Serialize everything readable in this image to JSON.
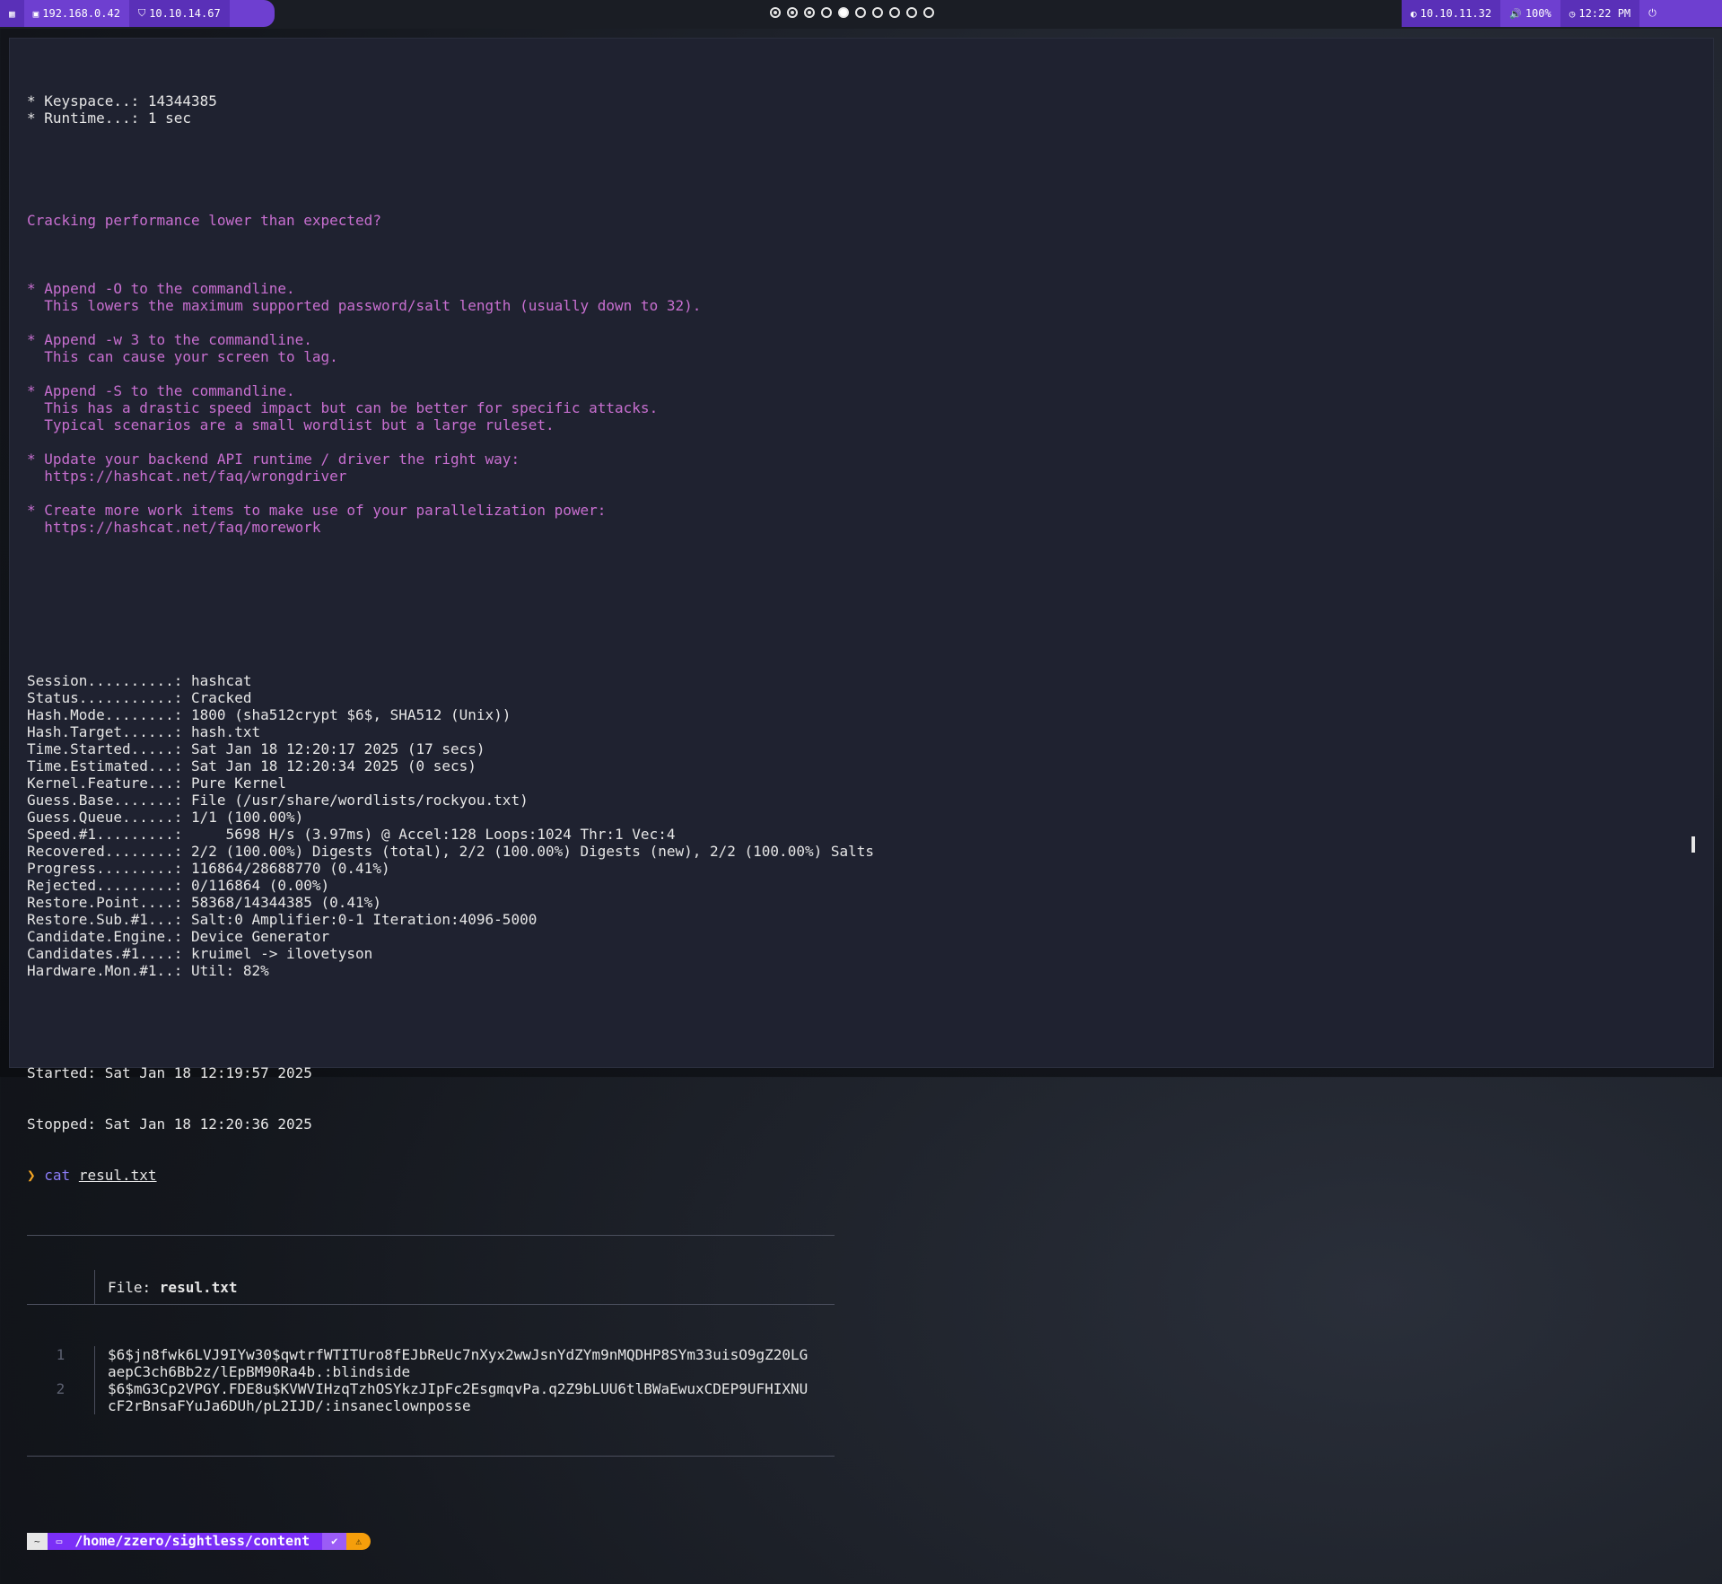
{
  "topbar": {
    "left": {
      "menu_icon": "grid-icon",
      "ip_local": "192.168.0.42",
      "ip_vpn": "10.10.14.67"
    },
    "workspaces": [
      {
        "state": "occupied"
      },
      {
        "state": "occupied"
      },
      {
        "state": "occupied"
      },
      {
        "state": "empty"
      },
      {
        "state": "active"
      },
      {
        "state": "empty"
      },
      {
        "state": "empty"
      },
      {
        "state": "empty"
      },
      {
        "state": "empty"
      },
      {
        "state": "empty"
      }
    ],
    "right": {
      "target_ip": "10.10.11.32",
      "volume": "100%",
      "clock": "12:22 PM",
      "power_icon": "power-icon"
    }
  },
  "terminal": {
    "header_lines": [
      "* Keyspace..: 14344385",
      "* Runtime...: 1 sec"
    ],
    "perf_title": "Cracking performance lower than expected?",
    "perf_blocks": [
      [
        "* Append -O to the commandline.",
        "  This lowers the maximum supported password/salt length (usually down to 32)."
      ],
      [
        "* Append -w 3 to the commandline.",
        "  This can cause your screen to lag."
      ],
      [
        "* Append -S to the commandline.",
        "  This has a drastic speed impact but can be better for specific attacks.",
        "  Typical scenarios are a small wordlist but a large ruleset."
      ],
      [
        "* Update your backend API runtime / driver the right way:",
        "  https://hashcat.net/faq/wrongdriver"
      ],
      [
        "* Create more work items to make use of your parallelization power:",
        "  https://hashcat.net/faq/morework"
      ]
    ],
    "status_lines": [
      "Session..........: hashcat",
      "Status...........: Cracked",
      "Hash.Mode........: 1800 (sha512crypt $6$, SHA512 (Unix))",
      "Hash.Target......: hash.txt",
      "Time.Started.....: Sat Jan 18 12:20:17 2025 (17 secs)",
      "Time.Estimated...: Sat Jan 18 12:20:34 2025 (0 secs)",
      "Kernel.Feature...: Pure Kernel",
      "Guess.Base.......: File (/usr/share/wordlists/rockyou.txt)",
      "Guess.Queue......: 1/1 (100.00%)",
      "Speed.#1.........:     5698 H/s (3.97ms) @ Accel:128 Loops:1024 Thr:1 Vec:4",
      "Recovered........: 2/2 (100.00%) Digests (total), 2/2 (100.00%) Digests (new), 2/2 (100.00%) Salts",
      "Progress.........: 116864/28688770 (0.41%)",
      "Rejected.........: 0/116864 (0.00%)",
      "Restore.Point....: 58368/14344385 (0.41%)",
      "Restore.Sub.#1...: Salt:0 Amplifier:0-1 Iteration:4096-5000",
      "Candidate.Engine.: Device Generator",
      "Candidates.#1....: kruimel -> ilovetyson",
      "Hardware.Mon.#1..: Util: 82%"
    ],
    "started": "Started: Sat Jan 18 12:19:57 2025",
    "stopped": "Stopped: Sat Jan 18 12:20:36 2025",
    "command": {
      "arrow": "❯",
      "cmd": "cat",
      "arg": "resul.txt"
    },
    "bat": {
      "file_label": "File: ",
      "file_name": "resul.txt",
      "rows": [
        {
          "num": "1",
          "lines": [
            "$6$jn8fwk6LVJ9IYw30$qwtrfWTITUro8fEJbReUc7nXyx2wwJsnYdZYm9nMQDHP8SYm33uisO9gZ20LG",
            "aepC3ch6Bb2z/lEpBM90Ra4b.:blindside"
          ]
        },
        {
          "num": "2",
          "lines": [
            "$6$mG3Cp2VPGY.FDE8u$KVWVIHzqTzhOSYkzJIpFc2EsgmqvPa.q2Z9bLUU6tlBWaEwuxCDEP9UFHIXNU",
            "cF2rBnsaFYuJa6DUh/pL2IJD/:insaneclownposse"
          ]
        }
      ]
    },
    "prompt": {
      "home_symbol": "~",
      "folder_icon": "folder-icon",
      "path_prefix": "/home/zzero/sightless/",
      "path_last": "content",
      "ok_symbol": "✔",
      "user_symbol": "⚠"
    }
  }
}
